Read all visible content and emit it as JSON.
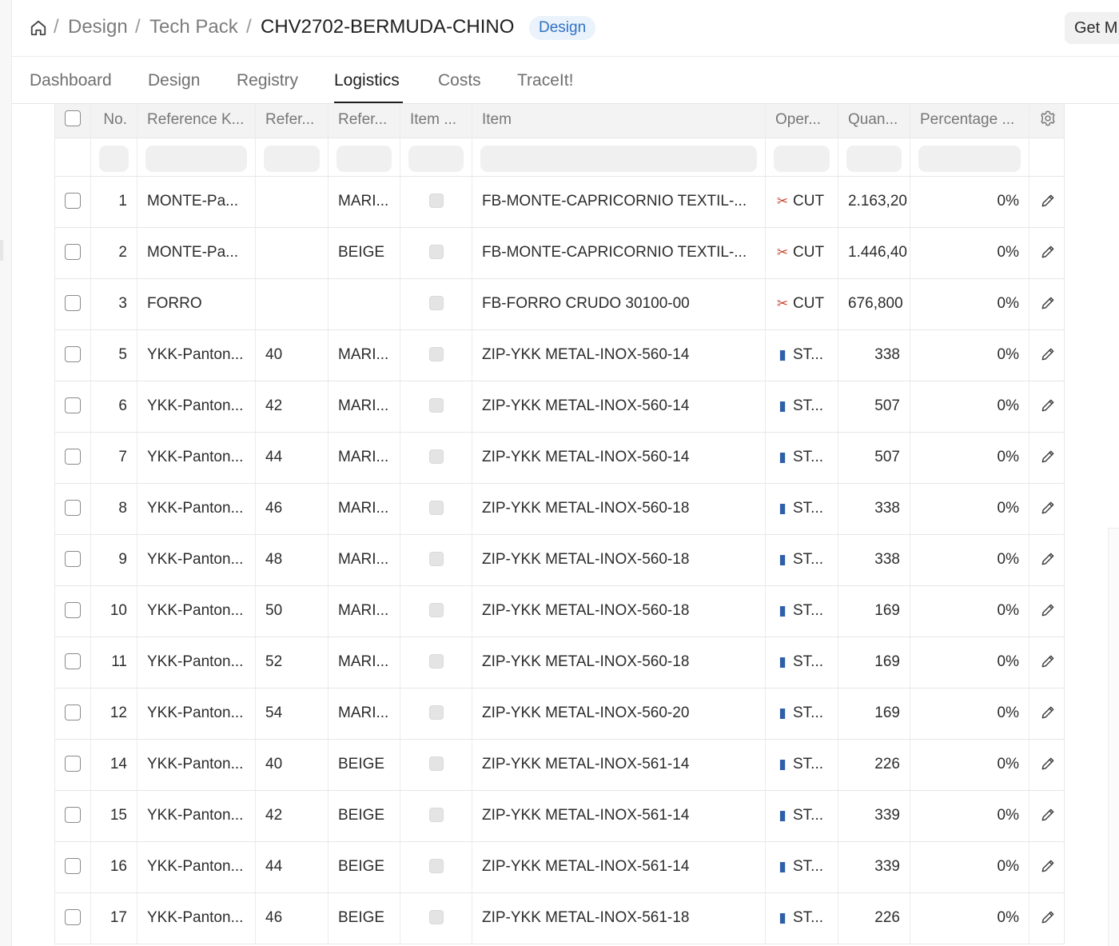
{
  "breadcrumb": {
    "items": [
      "Design",
      "Tech Pack"
    ],
    "separator": "/",
    "current": "CHV2702-BERMUDA-CHINO",
    "badge": "Design"
  },
  "header_action": {
    "label": "Get M"
  },
  "tabs": [
    {
      "label": "Dashboard",
      "active": false
    },
    {
      "label": "Design",
      "active": false
    },
    {
      "label": "Registry",
      "active": false
    },
    {
      "label": "Logistics",
      "active": true
    },
    {
      "label": "Costs",
      "active": false
    },
    {
      "label": "TraceIt!",
      "active": false
    }
  ],
  "table": {
    "columns": [
      "No.",
      "Reference K...",
      "Refer...",
      "Refer...",
      "Item ...",
      "Item",
      "Oper...",
      "Quan...",
      "Percentage ..."
    ],
    "rows": [
      {
        "no": "1",
        "ref_k": "MONTE-Pa...",
        "ref1": "",
        "ref2": "MARI...",
        "item": "FB-MONTE-CAPRICORNIO TEXTIL-...",
        "op_icon": "scissors-icon",
        "op": "CUT",
        "qty": "2.163,20",
        "qty_align": "left",
        "pct": "0%"
      },
      {
        "no": "2",
        "ref_k": "MONTE-Pa...",
        "ref1": "",
        "ref2": "BEIGE",
        "item": "FB-MONTE-CAPRICORNIO TEXTIL-...",
        "op_icon": "scissors-icon",
        "op": "CUT",
        "qty": "1.446,40",
        "qty_align": "left",
        "pct": "0%"
      },
      {
        "no": "3",
        "ref_k": "FORRO",
        "ref1": "",
        "ref2": "",
        "item": "FB-FORRO CRUDO 30100-00",
        "op_icon": "scissors-icon",
        "op": "CUT",
        "qty": "676,800",
        "qty_align": "left",
        "pct": "0%"
      },
      {
        "no": "5",
        "ref_k": "YKK-Panton...",
        "ref1": "40",
        "ref2": "MARI...",
        "item": "ZIP-YKK METAL-INOX-560-14",
        "op_icon": "thread-spool-icon",
        "op": "ST...",
        "qty": "338",
        "qty_align": "right",
        "pct": "0%"
      },
      {
        "no": "6",
        "ref_k": "YKK-Panton...",
        "ref1": "42",
        "ref2": "MARI...",
        "item": "ZIP-YKK METAL-INOX-560-14",
        "op_icon": "thread-spool-icon",
        "op": "ST...",
        "qty": "507",
        "qty_align": "right",
        "pct": "0%"
      },
      {
        "no": "7",
        "ref_k": "YKK-Panton...",
        "ref1": "44",
        "ref2": "MARI...",
        "item": "ZIP-YKK METAL-INOX-560-14",
        "op_icon": "thread-spool-icon",
        "op": "ST...",
        "qty": "507",
        "qty_align": "right",
        "pct": "0%"
      },
      {
        "no": "8",
        "ref_k": "YKK-Panton...",
        "ref1": "46",
        "ref2": "MARI...",
        "item": "ZIP-YKK METAL-INOX-560-18",
        "op_icon": "thread-spool-icon",
        "op": "ST...",
        "qty": "338",
        "qty_align": "right",
        "pct": "0%"
      },
      {
        "no": "9",
        "ref_k": "YKK-Panton...",
        "ref1": "48",
        "ref2": "MARI...",
        "item": "ZIP-YKK METAL-INOX-560-18",
        "op_icon": "thread-spool-icon",
        "op": "ST...",
        "qty": "338",
        "qty_align": "right",
        "pct": "0%"
      },
      {
        "no": "10",
        "ref_k": "YKK-Panton...",
        "ref1": "50",
        "ref2": "MARI...",
        "item": "ZIP-YKK METAL-INOX-560-18",
        "op_icon": "thread-spool-icon",
        "op": "ST...",
        "qty": "169",
        "qty_align": "right",
        "pct": "0%"
      },
      {
        "no": "11",
        "ref_k": "YKK-Panton...",
        "ref1": "52",
        "ref2": "MARI...",
        "item": "ZIP-YKK METAL-INOX-560-18",
        "op_icon": "thread-spool-icon",
        "op": "ST...",
        "qty": "169",
        "qty_align": "right",
        "pct": "0%"
      },
      {
        "no": "12",
        "ref_k": "YKK-Panton...",
        "ref1": "54",
        "ref2": "MARI...",
        "item": "ZIP-YKK METAL-INOX-560-20",
        "op_icon": "thread-spool-icon",
        "op": "ST...",
        "qty": "169",
        "qty_align": "right",
        "pct": "0%"
      },
      {
        "no": "14",
        "ref_k": "YKK-Panton...",
        "ref1": "40",
        "ref2": "BEIGE",
        "item": "ZIP-YKK METAL-INOX-561-14",
        "op_icon": "thread-spool-icon",
        "op": "ST...",
        "qty": "226",
        "qty_align": "right",
        "pct": "0%"
      },
      {
        "no": "15",
        "ref_k": "YKK-Panton...",
        "ref1": "42",
        "ref2": "BEIGE",
        "item": "ZIP-YKK METAL-INOX-561-14",
        "op_icon": "thread-spool-icon",
        "op": "ST...",
        "qty": "339",
        "qty_align": "right",
        "pct": "0%"
      },
      {
        "no": "16",
        "ref_k": "YKK-Panton...",
        "ref1": "44",
        "ref2": "BEIGE",
        "item": "ZIP-YKK METAL-INOX-561-14",
        "op_icon": "thread-spool-icon",
        "op": "ST...",
        "qty": "339",
        "qty_align": "right",
        "pct": "0%"
      },
      {
        "no": "17",
        "ref_k": "YKK-Panton...",
        "ref1": "46",
        "ref2": "BEIGE",
        "item": "ZIP-YKK METAL-INOX-561-18",
        "op_icon": "thread-spool-icon",
        "op": "ST...",
        "qty": "226",
        "qty_align": "right",
        "pct": "0%"
      }
    ]
  },
  "colors": {
    "accent": "#2f72c5",
    "badge_bg": "#eaf2fb",
    "header_bg": "#f3f3f3",
    "cut_icon": "#c8452f",
    "spool_icon": "#2f5fa8"
  }
}
